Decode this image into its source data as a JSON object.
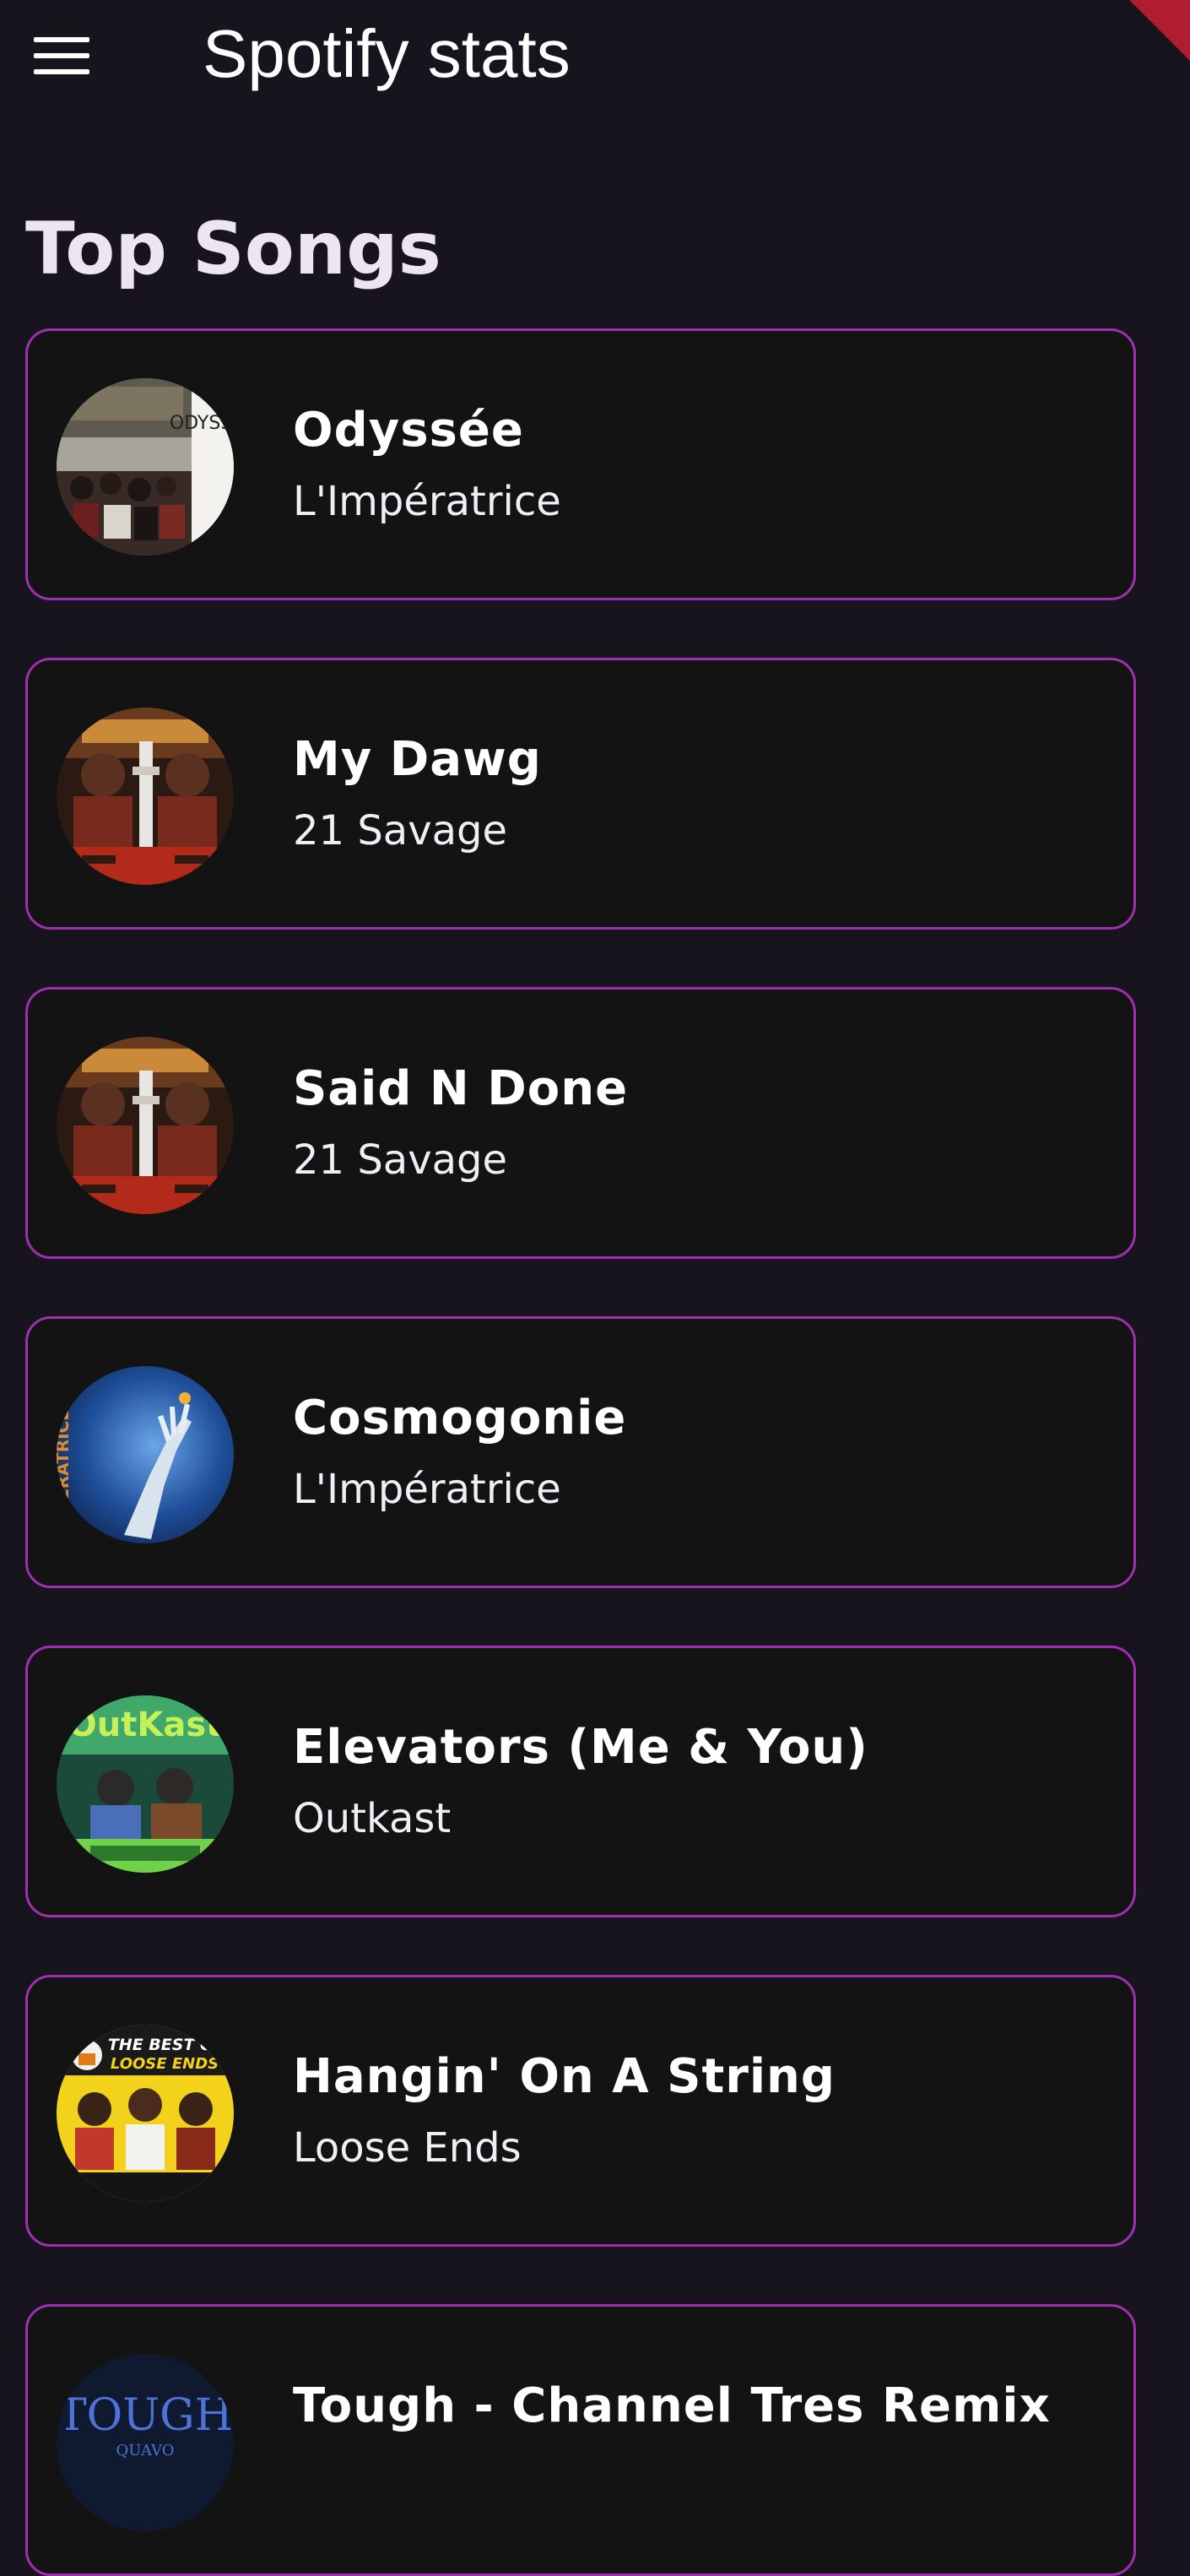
{
  "app_bar": {
    "title": "Spotify stats",
    "menu_icon": "hamburger-menu-icon"
  },
  "section": {
    "title": "Top Songs"
  },
  "colors": {
    "background": "#17141d",
    "card_background": "#131313",
    "card_border": "#9e2fb0",
    "debug_banner": "#b01c30"
  },
  "songs": [
    {
      "title": "Odyssée",
      "artist": "L'Impératrice",
      "art": "odyssee-album-art"
    },
    {
      "title": "My Dawg",
      "artist": "21 Savage",
      "art": "savage-mode-album-art"
    },
    {
      "title": "Said N Done",
      "artist": "21 Savage",
      "art": "savage-mode-album-art"
    },
    {
      "title": "Cosmogonie",
      "artist": "L'Impératrice",
      "art": "cosmogonie-album-art"
    },
    {
      "title": "Elevators (Me & You)",
      "artist": "Outkast",
      "art": "outkast-album-art"
    },
    {
      "title": "Hangin' On A String",
      "artist": "Loose Ends",
      "art": "loose-ends-album-art"
    },
    {
      "title": "Tough - Channel Tres Remix",
      "artist": "",
      "art": "tough-album-art"
    }
  ],
  "album_art_text": {
    "odyssee": "ODYSSÉE",
    "cosmogonie": "ÉRATRICE",
    "outkast": "OutKast",
    "loose_ends_line1": "THE BEST OF",
    "loose_ends_line2": "LOOSE ENDS",
    "tough_line1": "TOUGH",
    "tough_line2": "QUAVO"
  }
}
